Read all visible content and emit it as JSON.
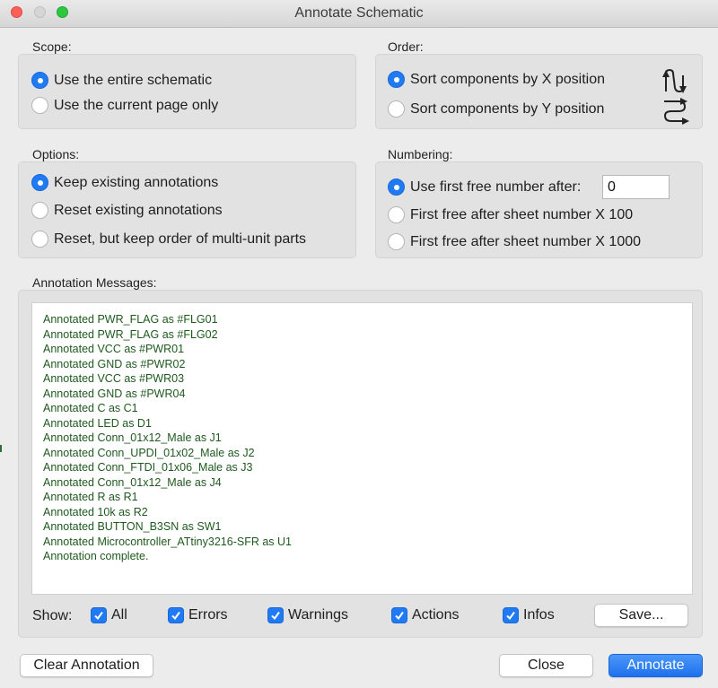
{
  "window": {
    "title": "Annotate Schematic"
  },
  "scope": {
    "label": "Scope:",
    "options": [
      {
        "label": "Use the entire schematic",
        "selected": true
      },
      {
        "label": "Use the current page only",
        "selected": false
      }
    ]
  },
  "order": {
    "label": "Order:",
    "options": [
      {
        "label": "Sort components by X position",
        "selected": true,
        "icon": "sort-x-icon"
      },
      {
        "label": "Sort components by Y position",
        "selected": false,
        "icon": "sort-y-icon"
      }
    ]
  },
  "options": {
    "label": "Options:",
    "options": [
      {
        "label": "Keep existing annotations",
        "selected": true
      },
      {
        "label": "Reset existing annotations",
        "selected": false
      },
      {
        "label": "Reset, but keep order of multi-unit parts",
        "selected": false
      }
    ]
  },
  "numbering": {
    "label": "Numbering:",
    "options": [
      {
        "label": "Use first free number after:",
        "selected": true
      },
      {
        "label": "First free after sheet number X 100",
        "selected": false
      },
      {
        "label": "First free after sheet number X 1000",
        "selected": false
      }
    ],
    "start_value": "0"
  },
  "messages": {
    "label": "Annotation Messages:",
    "lines": [
      "Annotated PWR_FLAG as #FLG01",
      "Annotated PWR_FLAG as #FLG02",
      "Annotated VCC as #PWR01",
      "Annotated GND as #PWR02",
      "Annotated VCC as #PWR03",
      "Annotated GND as #PWR04",
      "Annotated C as C1",
      "Annotated LED as D1",
      "Annotated Conn_01x12_Male as J1",
      "Annotated Conn_UPDI_01x02_Male as J2",
      "Annotated Conn_FTDI_01x06_Male as J3",
      "Annotated Conn_01x12_Male as J4",
      "Annotated R as R1",
      "Annotated 10k as R2",
      "Annotated BUTTON_B3SN as SW1",
      "Annotated Microcontroller_ATtiny3216-SFR as U1",
      "Annotation complete."
    ],
    "text_color": "#1e5a1e"
  },
  "filters": {
    "show_label": "Show:",
    "items": [
      {
        "label": "All",
        "checked": true
      },
      {
        "label": "Errors",
        "checked": true
      },
      {
        "label": "Warnings",
        "checked": true
      },
      {
        "label": "Actions",
        "checked": true
      },
      {
        "label": "Infos",
        "checked": true
      }
    ],
    "save_label": "Save..."
  },
  "buttons": {
    "clear": "Clear Annotation",
    "close": "Close",
    "annotate": "Annotate"
  },
  "colors": {
    "accent": "#1f7af3"
  }
}
